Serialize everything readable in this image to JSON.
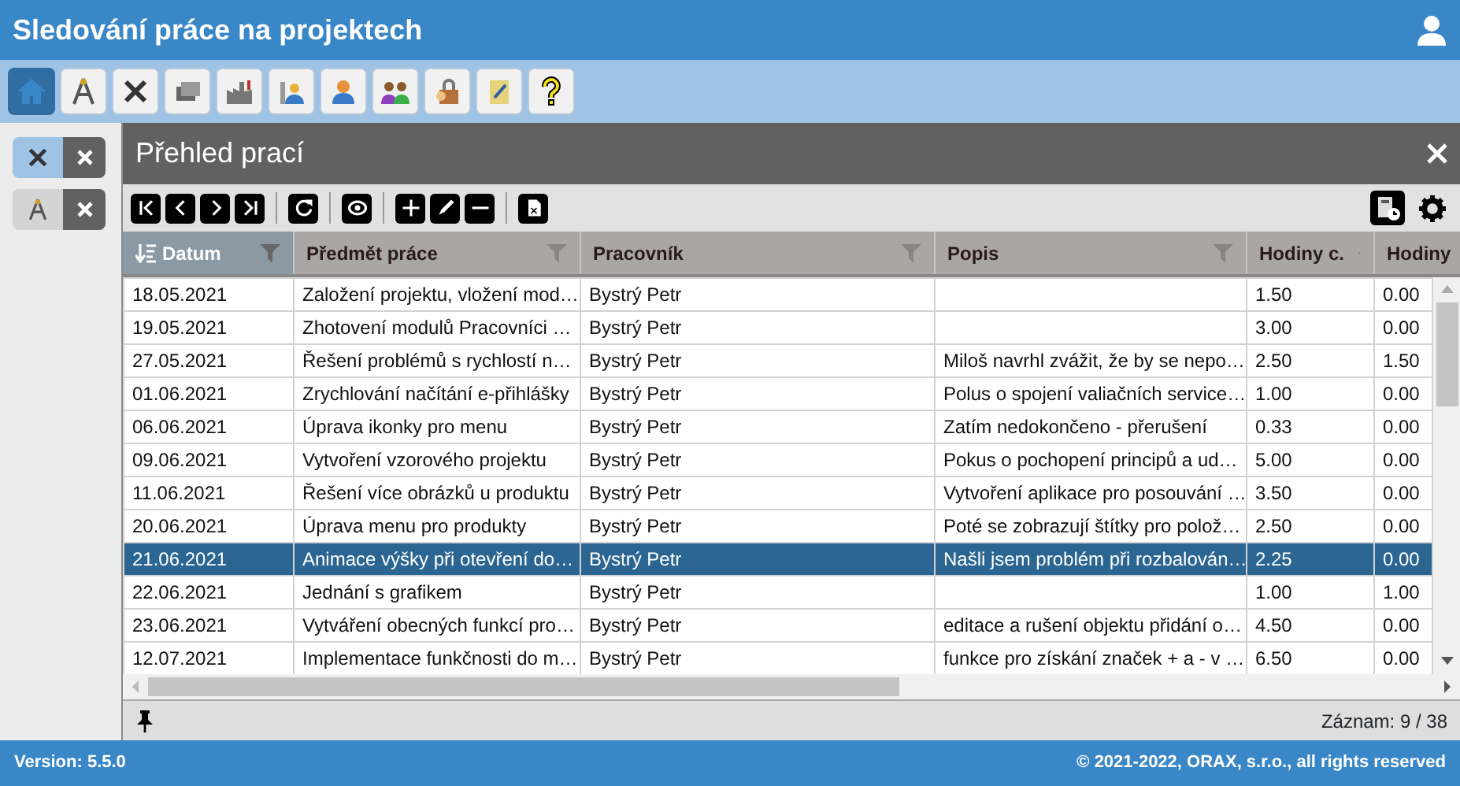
{
  "app": {
    "title": "Sledování práce na projektech"
  },
  "toolbar": [
    {
      "selected": true
    },
    {
      "selected": false
    },
    {
      "selected": false
    },
    {
      "selected": false
    },
    {
      "selected": false
    },
    {
      "selected": false
    },
    {
      "selected": false
    },
    {
      "selected": false
    },
    {
      "selected": false
    },
    {
      "selected": false
    },
    {
      "selected": false
    }
  ],
  "open_tabs": [
    {
      "selected": true
    },
    {
      "selected": false
    }
  ],
  "panel": {
    "title": "Přehled prací"
  },
  "table": {
    "columns": [
      {
        "label": "Datum",
        "sorted": true,
        "filter": true
      },
      {
        "label": "Předmět práce",
        "sorted": false,
        "filter": true
      },
      {
        "label": "Pracovník",
        "sorted": false,
        "filter": true
      },
      {
        "label": "Popis",
        "sorted": false,
        "filter": true
      },
      {
        "label": "Hodiny c.",
        "sorted": false,
        "filter": true
      },
      {
        "label": "Hodiny",
        "sorted": false
      }
    ],
    "rows": [
      {
        "selected": false,
        "cells": [
          "18.05.2021",
          "Založení projektu, vložení mod…",
          "Bystrý Petr",
          "",
          "1.50",
          "0.00"
        ]
      },
      {
        "selected": false,
        "cells": [
          "19.05.2021",
          "Zhotovení modulů Pracovníci …",
          "Bystrý Petr",
          "",
          "3.00",
          "0.00"
        ]
      },
      {
        "selected": false,
        "cells": [
          "27.05.2021",
          "Řešení problémů s rychlostí n…",
          "Bystrý Petr",
          "Miloš navrhl zvážit, že by se nepo…",
          "2.50",
          "1.50"
        ]
      },
      {
        "selected": false,
        "cells": [
          "01.06.2021",
          "Zrychlování načítání e-přihlášky",
          "Bystrý Petr",
          "Polus o spojení valiačních service…",
          "1.00",
          "0.00"
        ]
      },
      {
        "selected": false,
        "cells": [
          "06.06.2021",
          "Úprava ikonky pro menu",
          "Bystrý Petr",
          "Zatím nedokončeno - přerušení",
          "0.33",
          "0.00"
        ]
      },
      {
        "selected": false,
        "cells": [
          "09.06.2021",
          "Vytvoření vzorového projektu",
          "Bystrý Petr",
          "Pokus o pochopení principů a ud…",
          "5.00",
          "0.00"
        ]
      },
      {
        "selected": false,
        "cells": [
          "11.06.2021",
          "Řešení více obrázků u produktu",
          "Bystrý Petr",
          "Vytvoření aplikace pro posouvání …",
          "3.50",
          "0.00"
        ]
      },
      {
        "selected": false,
        "cells": [
          "20.06.2021",
          "Úprava menu pro produkty",
          "Bystrý Petr",
          "Poté se zobrazují štítky pro polož…",
          "2.50",
          "0.00"
        ]
      },
      {
        "selected": true,
        "cells": [
          "21.06.2021",
          "Animace výšky při otevření do…",
          "Bystrý Petr",
          "Našli jsem problém při rozbalován…",
          "2.25",
          "0.00"
        ]
      },
      {
        "selected": false,
        "cells": [
          "22.06.2021",
          "Jednání s grafikem",
          "Bystrý Petr",
          "",
          "1.00",
          "1.00"
        ]
      },
      {
        "selected": false,
        "cells": [
          "23.06.2021",
          "Vytváření obecných funkcí pro…",
          "Bystrý Petr",
          "editace a rušení objektu přidání o…",
          "4.50",
          "0.00"
        ]
      },
      {
        "selected": false,
        "cells": [
          "12.07.2021",
          "Implementace funkčnosti do m…",
          "Bystrý Petr",
          "funkce pro získání značek + a - v …",
          "6.50",
          "0.00"
        ]
      }
    ]
  },
  "status": {
    "record": "Záznam: 9 / 38"
  },
  "footer": {
    "version": "Version: 5.5.0",
    "copyright": "© 2021-2022, ORAX, s.r.o., all rights reserved"
  }
}
